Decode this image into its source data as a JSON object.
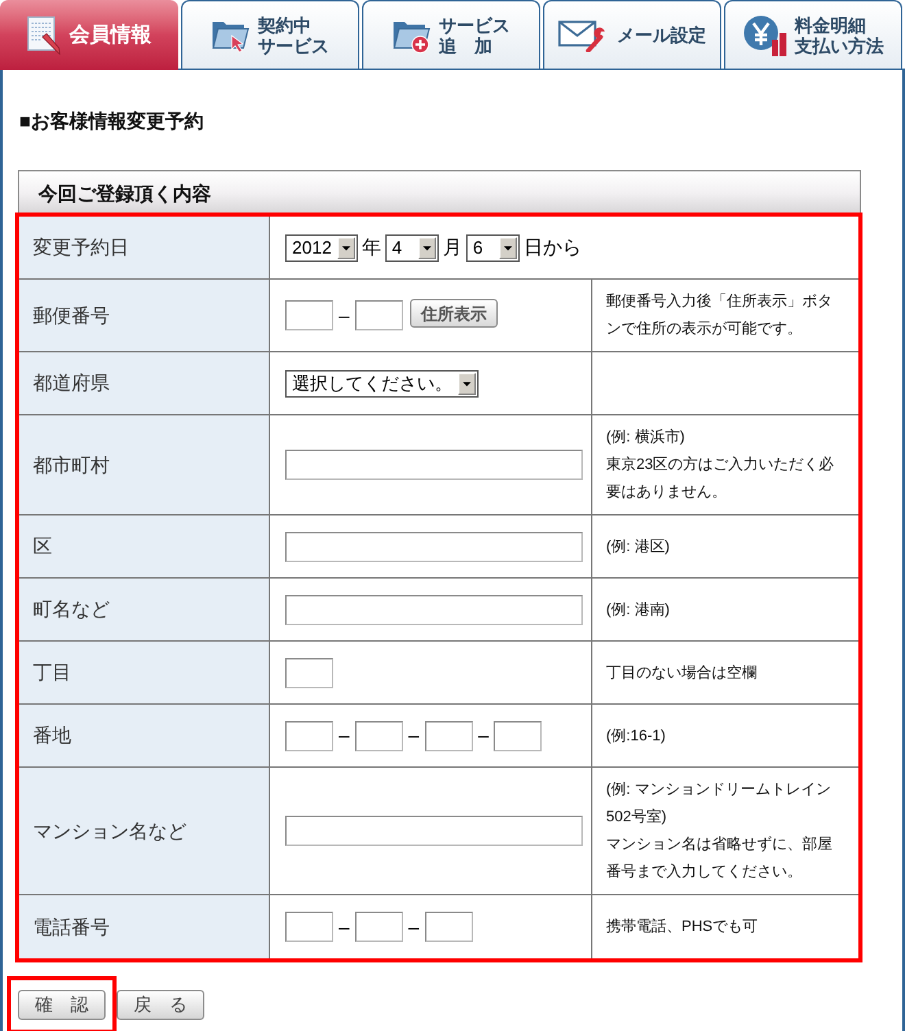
{
  "tabs": [
    {
      "lines": [
        "会員情報"
      ],
      "selected": true
    },
    {
      "lines": [
        "契約中",
        "サービス"
      ],
      "selected": false
    },
    {
      "lines": [
        "サービス",
        "追　加"
      ],
      "selected": false
    },
    {
      "lines": [
        "メール設定"
      ],
      "selected": false
    },
    {
      "lines": [
        "料金明細",
        "支払い方法"
      ],
      "selected": false
    }
  ],
  "page_title": "■お客様情報変更予約",
  "form": {
    "title": "今回ご登録頂く内容",
    "highlighted": true,
    "rows": [
      {
        "label": "変更予約日",
        "kind": "span",
        "controls": [
          {
            "kind": "select",
            "value": "2012"
          },
          {
            "kind": "unit",
            "text": "年"
          },
          {
            "kind": "select",
            "value": "4"
          },
          {
            "kind": "unit",
            "text": "月"
          },
          {
            "kind": "select",
            "value": "6"
          },
          {
            "kind": "unit",
            "text": "日から"
          }
        ]
      },
      {
        "label": "郵便番号",
        "kind": "split",
        "controls": [
          {
            "kind": "box"
          },
          {
            "kind": "dash",
            "text": "–"
          },
          {
            "kind": "box"
          },
          {
            "kind": "button",
            "text": "住所表示"
          }
        ],
        "notes": [
          "郵便番号入力後「住所表示」ボタンで住所の表示が可能です。"
        ]
      },
      {
        "label": "都道府県",
        "kind": "split",
        "controls": [
          {
            "kind": "select",
            "value": "選択してください。"
          }
        ]
      },
      {
        "label": "都市町村",
        "kind": "split",
        "controls": [
          {
            "kind": "long"
          }
        ],
        "notes": [
          "(例: 横浜市)",
          "東京23区の方はご入力いただく必要はありません。"
        ]
      },
      {
        "label": "区",
        "kind": "split",
        "controls": [
          {
            "kind": "long"
          }
        ],
        "notes": [
          "(例: 港区)"
        ]
      },
      {
        "label": "町名など",
        "kind": "split",
        "controls": [
          {
            "kind": "long"
          }
        ],
        "notes": [
          "(例: 港南)"
        ]
      },
      {
        "label": "丁目",
        "kind": "split",
        "controls": [
          {
            "kind": "box"
          }
        ],
        "notes": [
          "丁目のない場合は空欄"
        ]
      },
      {
        "label": "番地",
        "kind": "split",
        "controls": [
          {
            "kind": "box"
          },
          {
            "kind": "dash",
            "text": "–"
          },
          {
            "kind": "box"
          },
          {
            "kind": "dash",
            "text": "–"
          },
          {
            "kind": "box"
          },
          {
            "kind": "dash",
            "text": "–"
          },
          {
            "kind": "box"
          }
        ],
        "notes": [
          "(例:16-1)"
        ]
      },
      {
        "label": "マンション名など",
        "kind": "split",
        "controls": [
          {
            "kind": "long"
          }
        ],
        "notes": [
          "(例: マンションドリームトレイン502号室)",
          "マンション名は省略せずに、部屋番号まで入力してください。"
        ]
      },
      {
        "label": "電話番号",
        "kind": "split",
        "controls": [
          {
            "kind": "box"
          },
          {
            "kind": "dash",
            "text": "–"
          },
          {
            "kind": "box"
          },
          {
            "kind": "dash",
            "text": "–"
          },
          {
            "kind": "box"
          }
        ],
        "notes": [
          "携帯電話、PHSでも可"
        ]
      }
    ]
  },
  "buttons": [
    {
      "label": "確　認",
      "highlighted": true
    },
    {
      "label": "戻　る",
      "highlighted": false
    }
  ]
}
